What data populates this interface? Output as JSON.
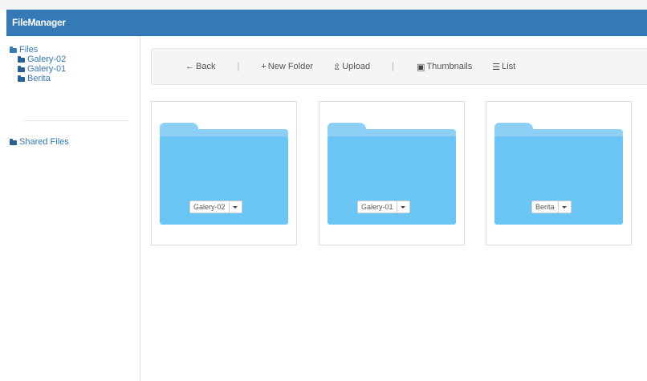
{
  "app": {
    "title": "FileManager"
  },
  "sidebar": {
    "root": {
      "label": "Files",
      "icon": "folder-open-icon"
    },
    "items": [
      {
        "label": "Galery-02",
        "icon": "folder-icon"
      },
      {
        "label": "Galery-01",
        "icon": "folder-icon"
      },
      {
        "label": "Berita",
        "icon": "folder-icon"
      }
    ],
    "shared": {
      "label": "Shared Files",
      "icon": "folder-icon"
    }
  },
  "toolbar": {
    "back_label": "Back",
    "back_icon": "arrow-left-icon",
    "separator": "|",
    "new_folder_label": "New Folder",
    "new_folder_icon": "plus-icon",
    "upload_label": "Upload",
    "upload_icon": "upload-icon",
    "thumbnails_label": "Thumbnails",
    "thumbnails_icon": "picture-icon",
    "list_label": "List",
    "list_icon": "list-icon"
  },
  "folders": [
    {
      "name": "Galery-02",
      "icon": "folder-icon"
    },
    {
      "name": "Galery-01",
      "icon": "folder-icon"
    },
    {
      "name": "Berita",
      "icon": "folder-icon"
    }
  ],
  "colors": {
    "header": "#337ab7",
    "link": "#337ab7",
    "folder_front": "#6ac5f5",
    "folder_back": "#8ed0f5"
  }
}
